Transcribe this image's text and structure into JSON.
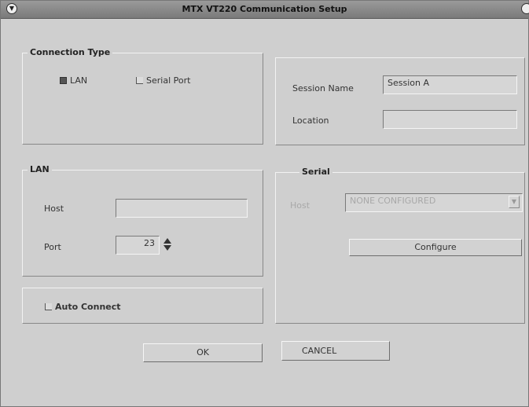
{
  "window": {
    "title": "MTX VT220 Communication Setup"
  },
  "connection_type": {
    "legend": "Connection Type",
    "options": [
      {
        "label": "LAN",
        "selected": true
      },
      {
        "label": "Serial Port",
        "selected": false
      }
    ]
  },
  "session": {
    "name_label": "Session Name",
    "name_value": "Session A",
    "location_label": "Location",
    "location_value": ""
  },
  "lan": {
    "legend": "LAN",
    "host_label": "Host",
    "host_value": "",
    "port_label": "Port",
    "port_value": "23"
  },
  "serial": {
    "legend": "Serial",
    "host_label": "Host",
    "host_value": "NONE CONFIGURED",
    "configure_label": "Configure"
  },
  "auto_connect": {
    "label": "Auto Connect",
    "checked": false
  },
  "buttons": {
    "ok": "OK",
    "cancel": "CANCEL"
  }
}
